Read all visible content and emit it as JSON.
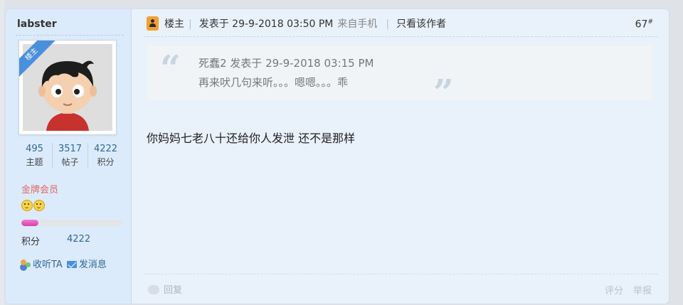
{
  "author": {
    "username": "labster",
    "host_badge": "楼主",
    "stats": [
      {
        "value": "495",
        "label": "主题"
      },
      {
        "value": "3517",
        "label": "帖子"
      },
      {
        "value": "4222",
        "label": "积分"
      }
    ],
    "rank_title": "金牌会员",
    "rank_icons": [
      "smiley-icon",
      "smiley-icon"
    ],
    "progress_fraction": 0.17,
    "points_label": "积分",
    "points_value": "4222",
    "follow_label": "收听TA",
    "message_label": "发消息"
  },
  "post": {
    "header": {
      "host_label": "楼主",
      "posted_text": "发表于 29-9-2018 03:50 PM",
      "source_text": "来自手机",
      "only_author_label": "只看该作者",
      "floor_number": "67",
      "floor_suffix": "#"
    },
    "quote": {
      "meta": "死蠢2 发表于 29-9-2018 03:15 PM",
      "text": "再来吠几句来听。。。嗯嗯。。。乖"
    },
    "message": "你妈妈七老八十还给你人发泄 还不是那样",
    "footer": {
      "reply_label": "回复",
      "rate_label": "评分",
      "report_label": "举报"
    }
  },
  "colors": {
    "sidebar_bg": "#dcebfb",
    "post_bg": "#e9f1fb",
    "link": "#336699",
    "rank": "#e26565",
    "progress": "#e255b8",
    "badge": "#4a8fdc",
    "host_icon": "#f0a030"
  }
}
